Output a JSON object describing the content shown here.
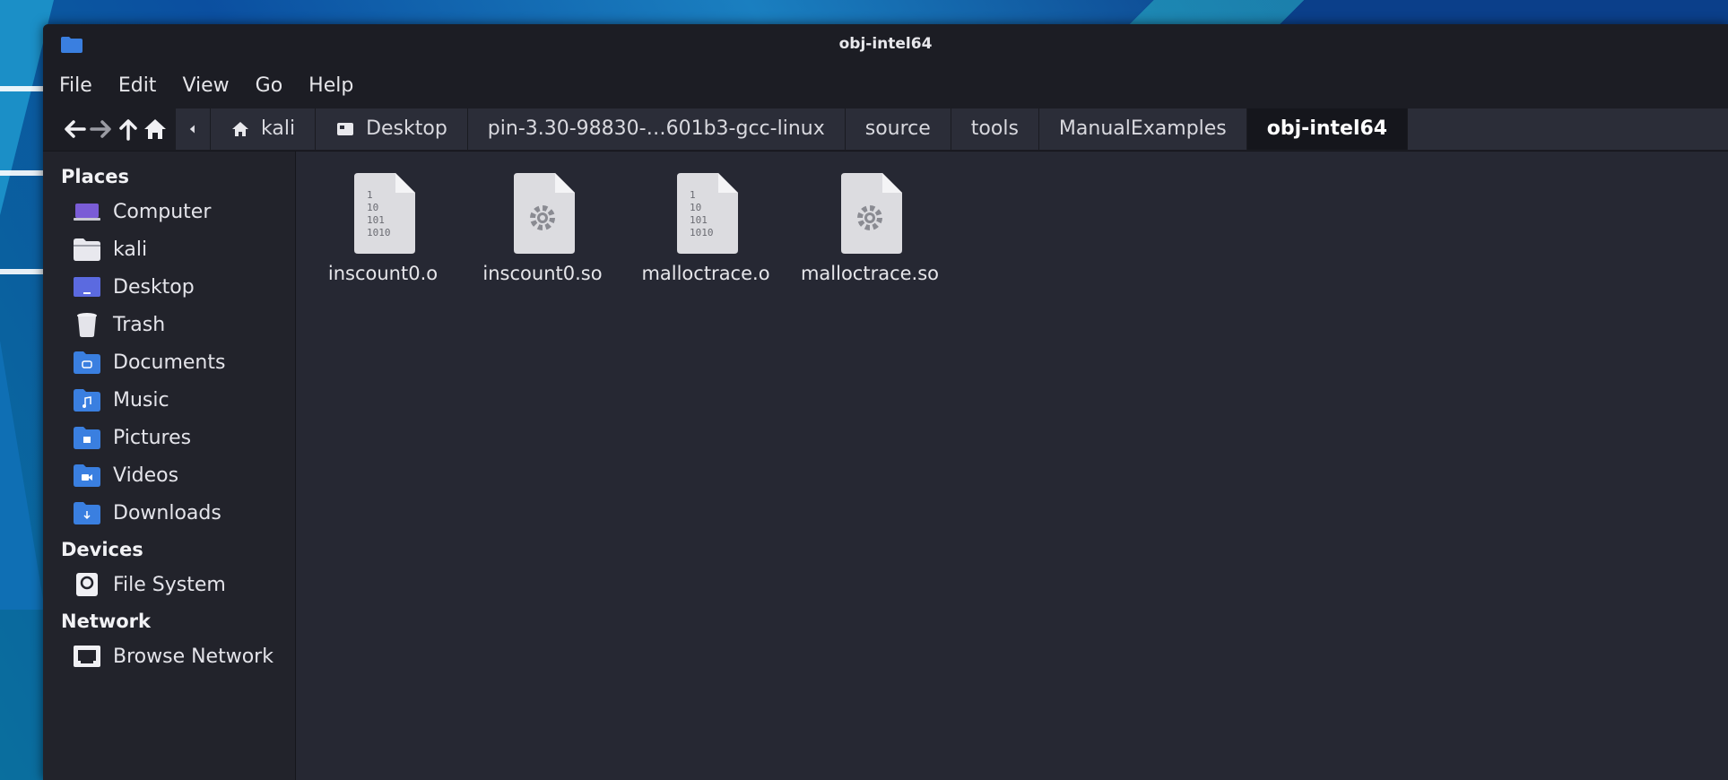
{
  "window": {
    "title": "obj-intel64"
  },
  "menubar": {
    "items": [
      "File",
      "Edit",
      "View",
      "Go",
      "Help"
    ]
  },
  "breadcrumbs": [
    {
      "label": "kali",
      "icon": "home-icon"
    },
    {
      "label": "Desktop",
      "icon": "desktop-icon"
    },
    {
      "label": "pin-3.30-98830-…601b3-gcc-linux"
    },
    {
      "label": "source"
    },
    {
      "label": "tools"
    },
    {
      "label": "ManualExamples"
    },
    {
      "label": "obj-intel64",
      "active": true
    }
  ],
  "sidebar": {
    "places_title": "Places",
    "places": [
      "Computer",
      "kali",
      "Desktop",
      "Trash",
      "Documents",
      "Music",
      "Pictures",
      "Videos",
      "Downloads"
    ],
    "devices_title": "Devices",
    "devices": [
      "File System"
    ],
    "network_title": "Network",
    "network": [
      "Browse Network"
    ]
  },
  "files": [
    {
      "name": "inscount0.o",
      "icon": "binary-file-icon"
    },
    {
      "name": "inscount0.so",
      "icon": "shared-library-icon"
    },
    {
      "name": "malloctrace.o",
      "icon": "binary-file-icon"
    },
    {
      "name": "malloctrace.so",
      "icon": "shared-library-icon"
    }
  ],
  "colors": {
    "accent_folder": "#3a7fe0",
    "window_bg": "#262833",
    "chrome_bg": "#1c1d24"
  }
}
